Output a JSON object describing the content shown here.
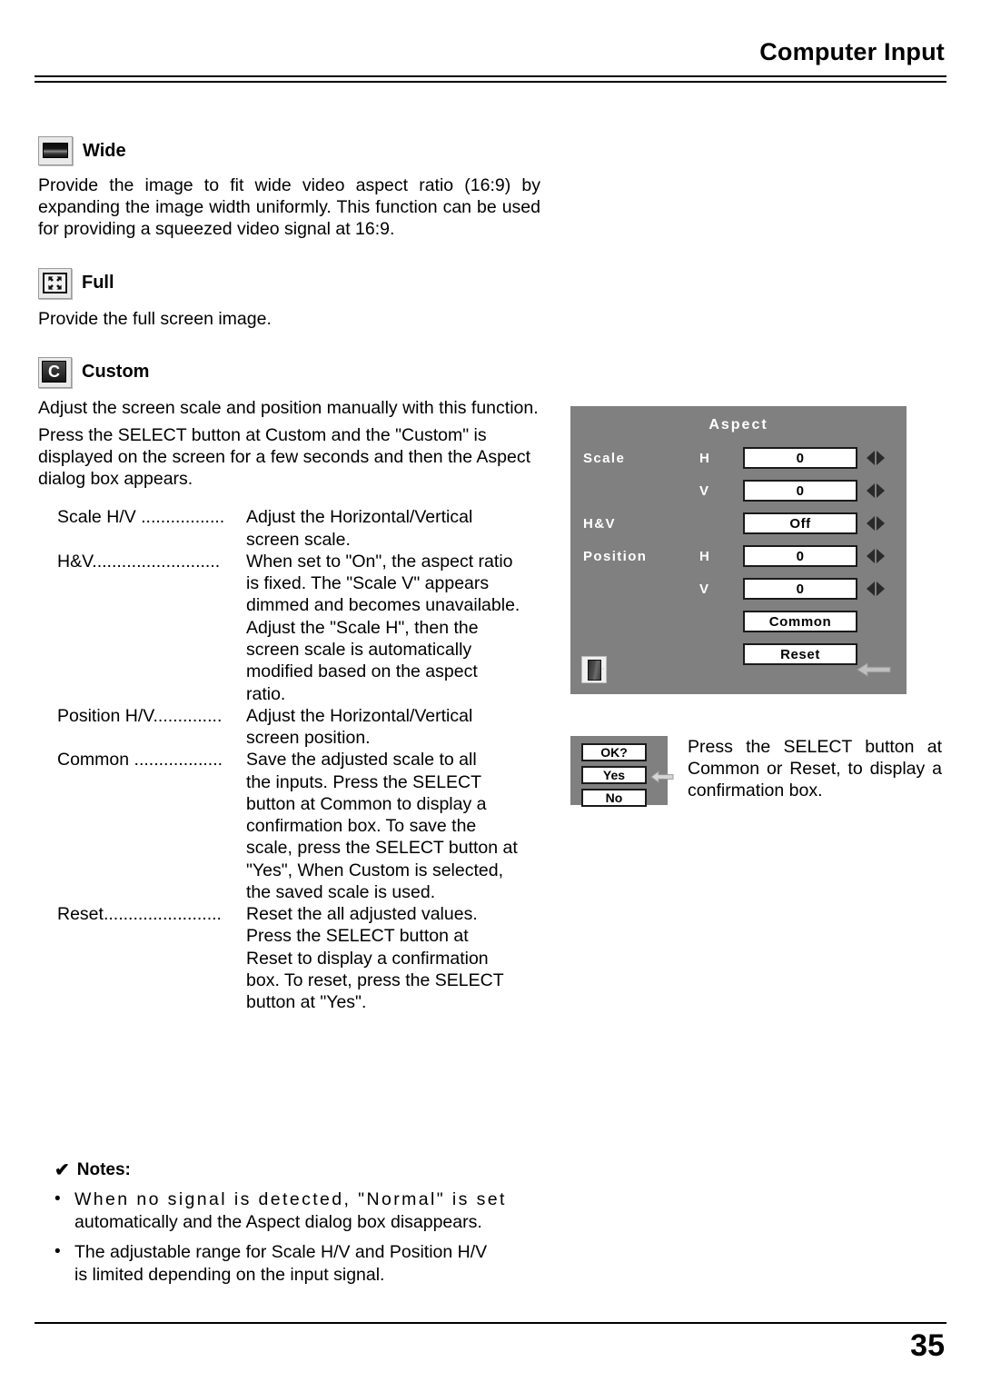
{
  "header": {
    "title": "Computer Input"
  },
  "modes": [
    {
      "icon": "wide-screen-icon",
      "title": "Wide",
      "paragraphs": [
        "Provide the image to fit wide video aspect ratio (16:9) by expanding the image width uniformly.  This function can be used for providing a squeezed video signal at 16:9."
      ]
    },
    {
      "icon": "full-screen-icon",
      "title": "Full",
      "paragraphs": [
        "Provide the full screen image."
      ]
    },
    {
      "icon": "custom-c-icon",
      "title": "Custom",
      "paragraphs": [
        "Adjust the screen scale and position manually with this function.",
        "Press the SELECT button at Custom and the \"Custom\" is displayed on the screen for a few seconds and then the Aspect dialog box appears."
      ]
    }
  ],
  "definitions": [
    {
      "term": "Scale H/V .................",
      "lines": [
        "Adjust the Horizontal/Vertical",
        "screen scale."
      ]
    },
    {
      "term": "H&V..........................",
      "lines": [
        "When set to \"On\", the aspect ratio",
        "is fixed. The \"Scale V\" appears",
        "dimmed and becomes unavailable.",
        "Adjust the \"Scale H\", then the",
        "screen scale is automatically",
        "modified based on the aspect",
        "ratio."
      ]
    },
    {
      "term": "Position H/V..............",
      "lines": [
        "Adjust the Horizontal/Vertical",
        "screen position."
      ]
    },
    {
      "term": "Common ..................",
      "lines": [
        "Save the adjusted scale to all",
        "the inputs. Press the SELECT",
        "button at Common to display a",
        "confirmation box. To save the",
        "scale, press the SELECT button at",
        "\"Yes\", When Custom is selected,",
        "the saved scale is used."
      ]
    },
    {
      "term": "Reset........................",
      "lines": [
        "Reset the all adjusted values.",
        "Press the SELECT button at",
        "Reset to display a confirmation",
        "box. To reset, press the SELECT",
        "button at \"Yes\"."
      ]
    }
  ],
  "osd": {
    "title": "Aspect",
    "background_color": "#808080",
    "rows": [
      {
        "label": "Scale",
        "axis": "H",
        "value": "0",
        "has_arrows": true
      },
      {
        "label": "",
        "axis": "V",
        "value": "0",
        "has_arrows": true
      },
      {
        "label": "H&V",
        "axis": "",
        "value": "Off",
        "has_arrows": true
      },
      {
        "label": "Position",
        "axis": "H",
        "value": "0",
        "has_arrows": true
      },
      {
        "label": "",
        "axis": "V",
        "value": "0",
        "has_arrows": true
      }
    ],
    "buttons": [
      {
        "label": "Common"
      },
      {
        "label": "Reset"
      }
    ],
    "exit_icon": "door-exit-icon",
    "back_icon": "back-arrow-icon"
  },
  "confirm": {
    "background_color": "#808080",
    "prompt": "OK?",
    "yes_label": "Yes",
    "no_label": "No",
    "pointer_icon": "left-arrow-pointer-icon"
  },
  "side_text": "Press the SELECT button at Common or Reset, to display a confirmation box.",
  "notes": {
    "check_glyph": "✔",
    "heading": "Notes:",
    "bullet": "•",
    "items": [
      {
        "spaced": "When no signal is detected, \"Normal\" is set",
        "rest": "automatically and the Aspect dialog box disappears."
      },
      {
        "spaced": "The adjustable range for Scale H/V and Position H/V",
        "rest": "is limited depending on the input signal."
      }
    ]
  },
  "footer": {
    "page_number": "35"
  }
}
